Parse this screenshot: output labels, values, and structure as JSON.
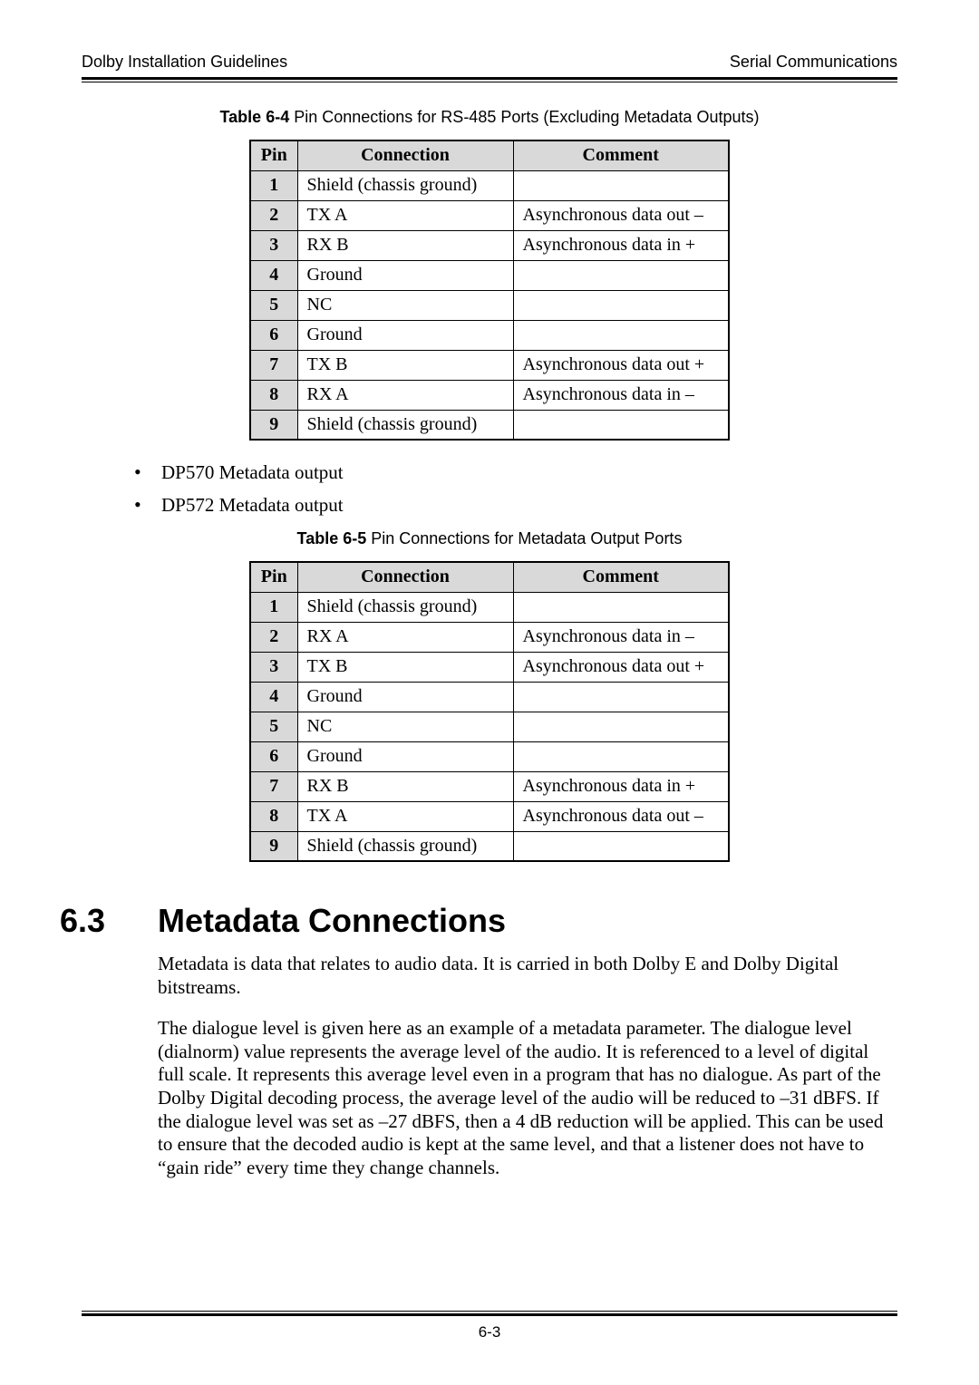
{
  "header": {
    "left": "Dolby Installation Guidelines",
    "right": "Serial Communications"
  },
  "table64": {
    "caption_bold": "Table 6-4",
    "caption_rest": " Pin Connections for RS-485 Ports (Excluding Metadata Outputs)",
    "headers": {
      "pin": "Pin",
      "connection": "Connection",
      "comment": "Comment"
    },
    "rows": [
      {
        "pin": "1",
        "connection": "Shield (chassis ground)",
        "comment": ""
      },
      {
        "pin": "2",
        "connection": "TX A",
        "comment": "Asynchronous data out –"
      },
      {
        "pin": "3",
        "connection": "RX B",
        "comment": "Asynchronous data in +"
      },
      {
        "pin": "4",
        "connection": "Ground",
        "comment": ""
      },
      {
        "pin": "5",
        "connection": "NC",
        "comment": ""
      },
      {
        "pin": "6",
        "connection": "Ground",
        "comment": ""
      },
      {
        "pin": "7",
        "connection": "TX B",
        "comment": "Asynchronous data out +"
      },
      {
        "pin": "8",
        "connection": "RX A",
        "comment": "Asynchronous data in –"
      },
      {
        "pin": "9",
        "connection": "Shield (chassis ground)",
        "comment": ""
      }
    ]
  },
  "bullets": {
    "item1": "DP570 Metadata output",
    "item2": "DP572 Metadata output"
  },
  "table65": {
    "caption_bold": "Table 6-5",
    "caption_rest": " Pin Connections for Metadata Output Ports",
    "headers": {
      "pin": "Pin",
      "connection": "Connection",
      "comment": "Comment"
    },
    "rows": [
      {
        "pin": "1",
        "connection": "Shield (chassis ground)",
        "comment": ""
      },
      {
        "pin": "2",
        "connection": "RX A",
        "comment": "Asynchronous data in –"
      },
      {
        "pin": "3",
        "connection": "TX B",
        "comment": "Asynchronous data out +"
      },
      {
        "pin": "4",
        "connection": "Ground",
        "comment": ""
      },
      {
        "pin": "5",
        "connection": "NC",
        "comment": ""
      },
      {
        "pin": "6",
        "connection": "Ground",
        "comment": ""
      },
      {
        "pin": "7",
        "connection": "RX B",
        "comment": "Asynchronous data in +"
      },
      {
        "pin": "8",
        "connection": "TX A",
        "comment": "Asynchronous data out –"
      },
      {
        "pin": "9",
        "connection": "Shield (chassis ground)",
        "comment": ""
      }
    ]
  },
  "section": {
    "number": "6.3",
    "title": "Metadata Connections",
    "para1": "Metadata is data that relates to audio data. It is carried in both Dolby E and Dolby Digital bitstreams.",
    "para2": "The dialogue level is given here as an example of a metadata parameter. The dialogue level (dialnorm) value represents the average level of the audio. It is referenced to a level of digital full scale. It represents this average level even in a program that has no dialogue. As part of the Dolby Digital decoding process, the average level of the audio will be reduced to –31 dBFS. If the dialogue level was set as –27 dBFS, then a 4 dB reduction will be applied. This can be used to ensure that the decoded audio is kept at the same level, and that a listener does not have to “gain ride” every time they change channels."
  },
  "footer": {
    "page": "6-3"
  }
}
